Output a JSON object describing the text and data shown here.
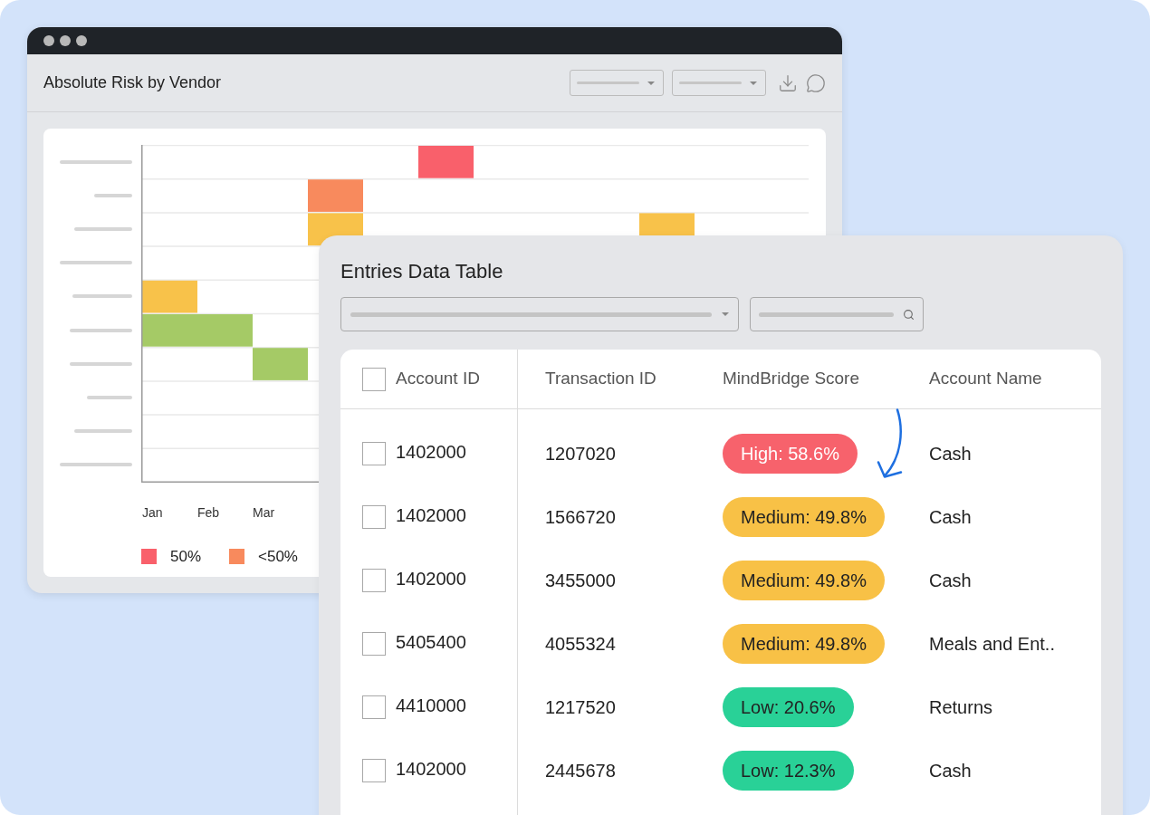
{
  "chart_window": {
    "title": "Absolute Risk by Vendor",
    "chart": {
      "x_labels": [
        "Jan",
        "Feb",
        "Mar"
      ],
      "legend": [
        {
          "label": "50%",
          "color": "#f9606b"
        },
        {
          "label": "<50%",
          "color": "#f88a5d"
        }
      ]
    }
  },
  "table_panel": {
    "title": "Entries Data Table",
    "header_checkbox": {
      "checked": false
    },
    "columns": [
      {
        "label": "Account ID"
      },
      {
        "label": "Transaction ID"
      },
      {
        "label": "MindBridge Score"
      },
      {
        "label": "Account Name"
      }
    ],
    "rows": [
      {
        "checked": false,
        "account_id": "1402000",
        "transaction_id": "1207020",
        "score": {
          "label": "High: 58.6%",
          "kind": "high"
        },
        "account_name": "Cash"
      },
      {
        "checked": false,
        "account_id": "1402000",
        "transaction_id": "1566720",
        "score": {
          "label": "Medium: 49.8%",
          "kind": "medium"
        },
        "account_name": "Cash"
      },
      {
        "checked": false,
        "account_id": "1402000",
        "transaction_id": "3455000",
        "score": {
          "label": "Medium: 49.8%",
          "kind": "medium"
        },
        "account_name": "Cash"
      },
      {
        "checked": false,
        "account_id": "5405400",
        "transaction_id": "4055324",
        "score": {
          "label": "Medium: 49.8%",
          "kind": "medium"
        },
        "account_name": "Meals and Ent.."
      },
      {
        "checked": false,
        "account_id": "4410000",
        "transaction_id": "1217520",
        "score": {
          "label": "Low: 20.6%",
          "kind": "low"
        },
        "account_name": "Returns"
      },
      {
        "checked": false,
        "account_id": "1402000",
        "transaction_id": "2445678",
        "score": {
          "label": "Low: 12.3%",
          "kind": "low"
        },
        "account_name": "Cash"
      }
    ]
  }
}
